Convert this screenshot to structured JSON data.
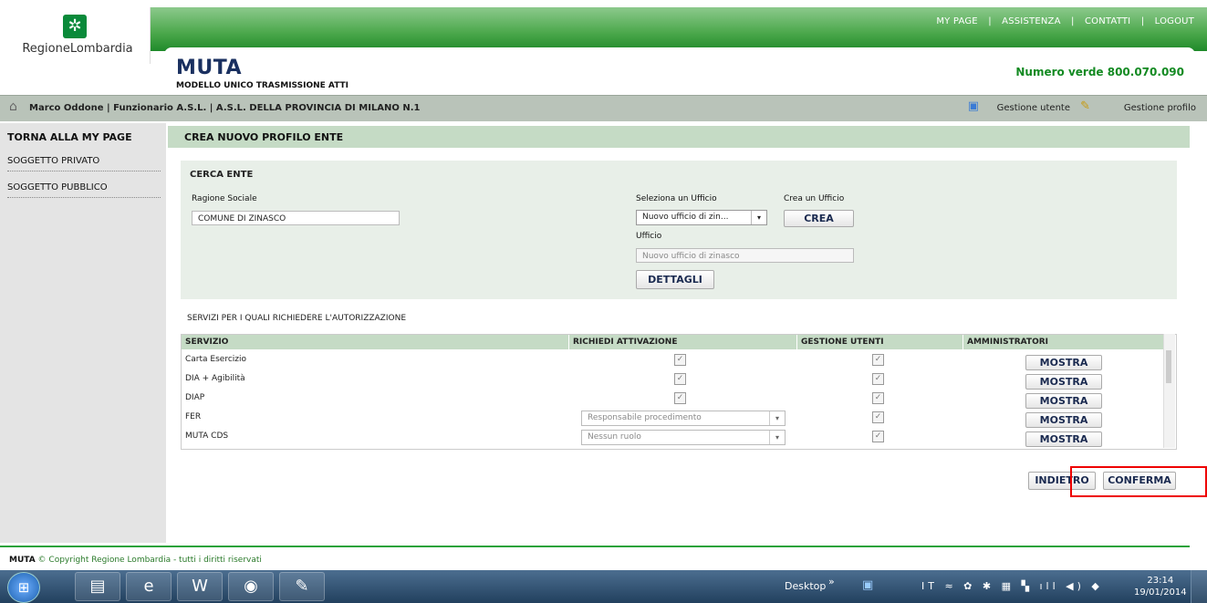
{
  "header": {
    "logo_text": "RegioneLombardia",
    "top_links": [
      "MY PAGE",
      "ASSISTENZA",
      "CONTATTI",
      "LOGOUT"
    ],
    "separator": "|",
    "app_title": "MUTA",
    "app_subtitle": "MODELLO UNICO TRASMISSIONE ATTI",
    "numero_verde": "Numero verde 800.070.090"
  },
  "userbar": {
    "user_info": "Marco Oddone | Funzionario A.S.L. | A.S.L. DELLA PROVINCIA DI MILANO N.1",
    "gestione_utente": "Gestione utente",
    "gestione_profilo": "Gestione profilo"
  },
  "sidebar": {
    "header": "TORNA ALLA MY PAGE",
    "items": [
      "SOGGETTO PRIVATO",
      "SOGGETTO PUBBLICO"
    ]
  },
  "main": {
    "title": "CREA NUOVO PROFILO ENTE",
    "cerca": {
      "title": "CERCA ENTE",
      "ragione_label": "Ragione Sociale",
      "ragione_value": "COMUNE DI ZINASCO",
      "seleziona_label": "Seleziona un Ufficio",
      "seleziona_value": "Nuovo ufficio di zin...",
      "crea_label": "Crea un Ufficio",
      "crea_button": "CREA",
      "ufficio_label": "Ufficio",
      "ufficio_value": "Nuovo ufficio di zinasco",
      "dettagli_button": "DETTAGLI"
    },
    "servizi_title": "SERVIZI PER I QUALI RICHIEDERE L'AUTORIZZAZIONE",
    "table": {
      "headers": [
        "SERVIZIO",
        "RICHIEDI ATTIVAZIONE",
        "GESTIONE UTENTI",
        "AMMINISTRATORI"
      ],
      "mostra_label": "MOSTRA",
      "rows": [
        {
          "servizio": "Carta Esercizio",
          "attivazione": "check",
          "dropdown": ""
        },
        {
          "servizio": "DIA + Agibilità",
          "attivazione": "check",
          "dropdown": ""
        },
        {
          "servizio": "DIAP",
          "attivazione": "check",
          "dropdown": ""
        },
        {
          "servizio": "FER",
          "attivazione": "dropdown",
          "dropdown": "Responsabile procedimento"
        },
        {
          "servizio": "MUTA CDS",
          "attivazione": "dropdown",
          "dropdown": "Nessun ruolo"
        }
      ]
    },
    "indietro_button": "INDIETRO",
    "conferma_button": "CONFERMA"
  },
  "footer": {
    "app": "MUTA",
    "copyright": "© Copyright Regione Lombardia - tutti i diritti riservati"
  },
  "taskbar": {
    "desktop_label": "Desktop",
    "lang": "IT",
    "time": "23:14",
    "date": "19/01/2014"
  },
  "colors": {
    "green": "#1f8a2a",
    "light_green": "#c5dbc5",
    "highlight": "#e00000"
  }
}
